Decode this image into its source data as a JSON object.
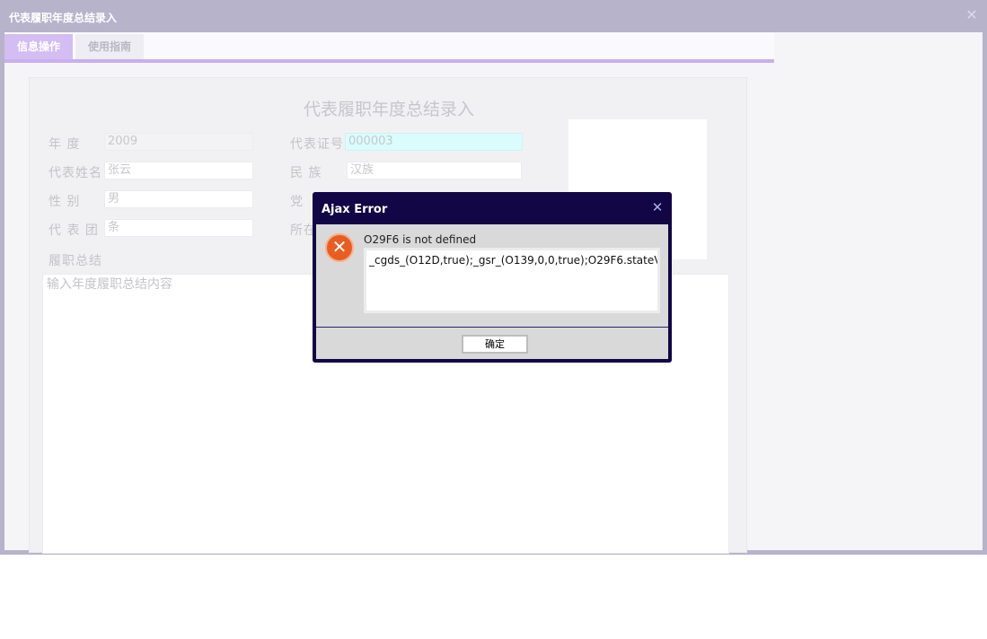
{
  "window": {
    "title": "代表履职年度总结录入",
    "close_glyph": "✕"
  },
  "tabs": [
    {
      "label": "信息操作",
      "active": true
    },
    {
      "label": "使用指南",
      "active": false
    }
  ],
  "form": {
    "title": "代表履职年度总结录入",
    "fields": {
      "year": {
        "label": "年 度",
        "value": "2009"
      },
      "rep_id": {
        "label": "代表证号",
        "value": "000003"
      },
      "rep_name": {
        "label": "代表姓名",
        "value": "张云"
      },
      "ethnicity": {
        "label": "民 族",
        "value": "汉族"
      },
      "gender": {
        "label": "性 别",
        "value": "男"
      },
      "party": {
        "label": "党"
      },
      "delegation": {
        "label": "代 表 团",
        "value": "条"
      },
      "location": {
        "label": "所在"
      }
    },
    "summary": {
      "label": "履职总结",
      "placeholder": "输入年度履职总结内容"
    }
  },
  "dialog": {
    "title": "Ajax Error",
    "close_glyph": "✕",
    "message": "O29F6 is not defined",
    "detail": "_cgds_(O12D,true);_gsr_(O139,0,0,true);O29F6.stateV",
    "ok_label": "确定",
    "icon": "error-x-icon"
  },
  "colors": {
    "window_frame": "#b7b3cb",
    "tab_active": "#d3bdf3",
    "dialog_frame": "#120646",
    "error_icon": "#e95d21"
  }
}
